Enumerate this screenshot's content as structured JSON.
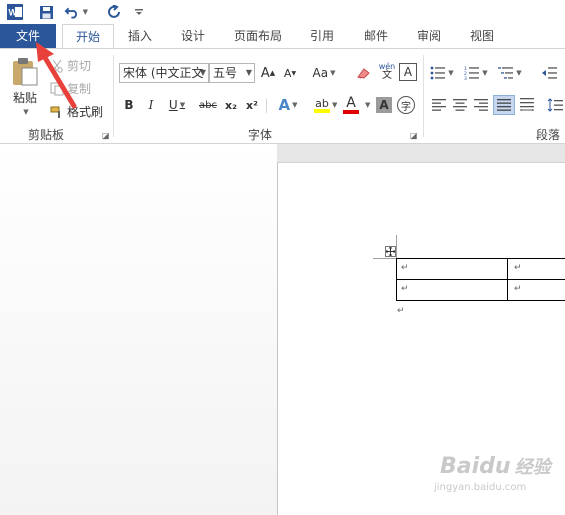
{
  "quick_access": {
    "word_icon": "word-app-icon",
    "save_icon": "save-icon",
    "undo_icon": "undo-icon",
    "redo_icon": "redo-icon",
    "customize_icon": "customize-toolbar-icon"
  },
  "tabs": [
    "文件",
    "开始",
    "插入",
    "设计",
    "页面布局",
    "引用",
    "邮件",
    "审阅",
    "视图"
  ],
  "active_tab": "开始",
  "ribbon": {
    "clipboard": {
      "paste_label": "粘贴",
      "cut_label": "剪切",
      "copy_label": "复制",
      "format_painter_label": "格式刷",
      "group_label": "剪贴板"
    },
    "font": {
      "font_name": "宋体 (中文正文",
      "font_size": "五号",
      "grow_label": "A",
      "shrink_label": "A",
      "case_label": "Aa",
      "pinyin_top": "wén",
      "pinyin_bottom": "文",
      "border_char_label": "A",
      "bold_label": "B",
      "italic_label": "I",
      "underline_label": "U",
      "strike_label": "abc",
      "subscript_label": "x₂",
      "superscript_label": "x²",
      "effects_label": "A",
      "highlight_label": "ab",
      "color_label": "A",
      "shading_label": "A",
      "enclose_label": "字",
      "group_label": "字体"
    },
    "paragraph": {
      "group_label": "段落"
    }
  },
  "document": {
    "table": {
      "rows": 2,
      "cols": 2,
      "cell_mark": "↵"
    },
    "paragraph_mark": "↵"
  },
  "watermark": {
    "brand": "Baidu",
    "brand_cn": "经验",
    "url": "jingyan.baidu.com"
  },
  "colors": {
    "accent": "#2b579a",
    "annotation_arrow": "#e8403a",
    "highlight_yellow": "#ffff00",
    "font_color_red": "#e00000"
  }
}
